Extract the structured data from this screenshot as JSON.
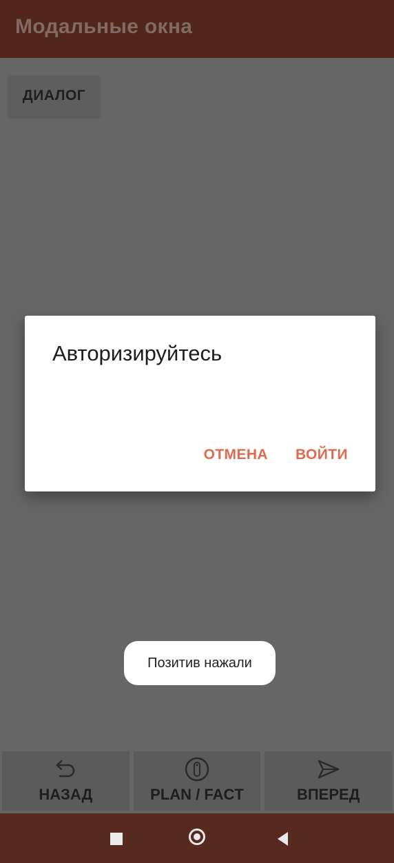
{
  "app_bar": {
    "title": "Модальные окна"
  },
  "main": {
    "dialog_button_label": "ДИАЛОГ"
  },
  "dialog": {
    "title": "Авторизируйтесь",
    "cancel_label": "ОТМЕНА",
    "confirm_label": "ВОЙТИ"
  },
  "toast": {
    "text": "Позитив нажали"
  },
  "bottom_nav": {
    "items": [
      {
        "label": "НАЗАД",
        "icon": "undo-icon"
      },
      {
        "label": "PLAN / FACT",
        "icon": "info-icon"
      },
      {
        "label": "ВПЕРЕД",
        "icon": "send-icon"
      }
    ]
  },
  "system_nav": {
    "icons": [
      "recents-icon",
      "home-icon",
      "back-icon"
    ]
  },
  "colors": {
    "app_bar": "#51261b",
    "scrim_background": "#666666",
    "accent": "#e06a4f",
    "system_bar": "#562a1e"
  }
}
